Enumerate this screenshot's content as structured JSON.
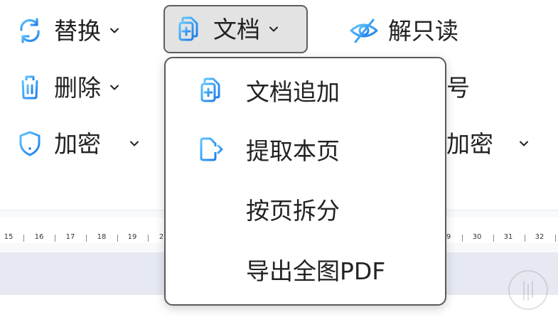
{
  "toolbar": {
    "replace_label": "替换",
    "doc_label": "文档",
    "readonly_label": "解只读",
    "delete_label": "删除",
    "encrypt_label": "加密",
    "hidden_number_fragment": "号",
    "hidden_encrypt_label": "加密"
  },
  "ruler": {
    "ticks_left": [
      "15",
      "16",
      "17",
      "18",
      "19",
      "2"
    ],
    "ticks_right": [
      "9",
      "30",
      "31",
      "32"
    ]
  },
  "menu": {
    "items": [
      {
        "label": "文档追加",
        "icon": "doc-append-icon"
      },
      {
        "label": "提取本页",
        "icon": "extract-page-icon"
      },
      {
        "label": "按页拆分",
        "icon": ""
      },
      {
        "label": "导出全图PDF",
        "icon": ""
      }
    ]
  },
  "colors": {
    "accent_blue": "#2b8ff0",
    "text": "#222222",
    "menu_border": "#5a5a5a",
    "doc_button_bg": "#e3e3e3"
  }
}
